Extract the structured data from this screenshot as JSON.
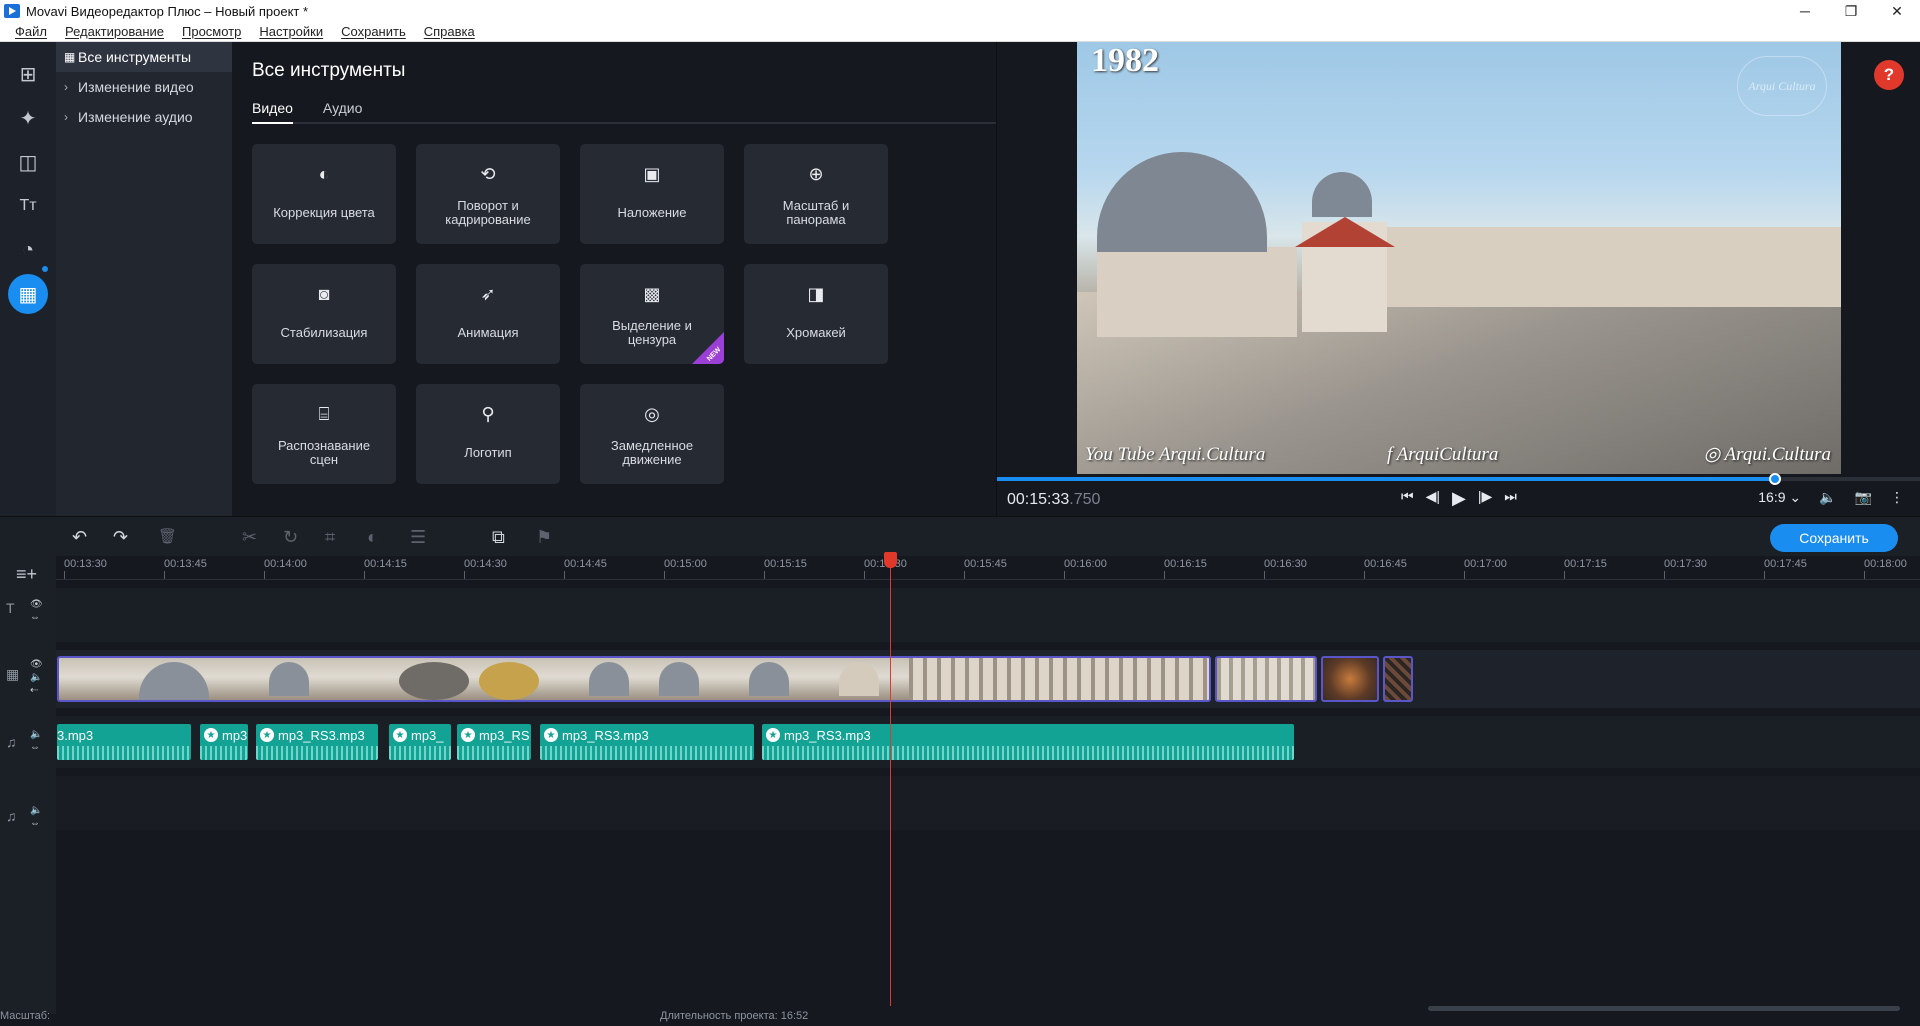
{
  "window": {
    "title": "Movavi Видеоредактор Плюс – Новый проект *",
    "controls": [
      "─",
      "❐",
      "✕"
    ]
  },
  "menu": [
    "Файл",
    "Редактирование",
    "Просмотр",
    "Настройки",
    "Сохранить",
    "Справка"
  ],
  "rail": {
    "icons": [
      "import-icon",
      "magic-wand-icon",
      "transitions-icon",
      "titles-icon",
      "filters-icon",
      "all-tools-icon"
    ],
    "glyphs": [
      "⊞",
      "✦",
      "◫",
      "Tт",
      "◔",
      "▦"
    ],
    "active_index": 5
  },
  "categories": [
    {
      "label": "Все инструменты",
      "icon": "▦",
      "active": true
    },
    {
      "label": "Изменение видео",
      "icon": "›",
      "active": false
    },
    {
      "label": "Изменение аудио",
      "icon": "›",
      "active": false
    }
  ],
  "tools": {
    "title": "Все инструменты",
    "tabs": [
      "Видео",
      "Аудио"
    ],
    "active_tab": 0,
    "cards": [
      {
        "label": "Коррекция цвета",
        "icon": "◐",
        "icon_name": "color-correction-icon"
      },
      {
        "label": "Поворот и кадрирование",
        "icon": "⟲",
        "icon_name": "rotate-crop-icon"
      },
      {
        "label": "Наложение",
        "icon": "▣",
        "icon_name": "overlay-icon"
      },
      {
        "label": "Масштаб и панорама",
        "icon": "⊕",
        "icon_name": "zoom-pan-icon"
      },
      {
        "label": "Стабилизация",
        "icon": "◙",
        "icon_name": "stabilization-icon"
      },
      {
        "label": "Анимация",
        "icon": "➶",
        "icon_name": "animation-icon"
      },
      {
        "label": "Выделение и цензура",
        "icon": "▩",
        "icon_name": "highlight-censor-icon",
        "badge": "NEW"
      },
      {
        "label": "Хромакей",
        "icon": "◨",
        "icon_name": "chroma-key-icon"
      },
      {
        "label": "Распознавание сцен",
        "icon": "⌸",
        "icon_name": "scene-detection-icon"
      },
      {
        "label": "Логотип",
        "icon": "⚲",
        "icon_name": "logo-icon"
      },
      {
        "label": "Замедленное движение",
        "icon": "◎",
        "icon_name": "slow-motion-icon"
      }
    ]
  },
  "preview": {
    "overlay_year": "1982",
    "watermark_logo": "Arqui Cultura",
    "watermarks": [
      "You Tube Arqui.Cultura",
      "f ArquiCultura",
      "◎ Arqui.Cultura"
    ],
    "help": "?",
    "timecode_main": "00:15:33",
    "timecode_ms": ".750",
    "progress": 0.842,
    "aspect": "16:9 ⌄",
    "playback_glyphs": [
      "⏮",
      "◀|",
      "▶",
      "|▶",
      "⏭"
    ],
    "right_glyphs": [
      "🔈",
      "📷",
      "⋮"
    ]
  },
  "toolbar": {
    "save_label": "Сохранить",
    "buttons": [
      {
        "name": "undo-icon",
        "glyph": "↶",
        "enabled": true
      },
      {
        "name": "redo-icon",
        "glyph": "↷",
        "enabled": true
      },
      {
        "name": "delete-icon",
        "glyph": "🗑",
        "enabled": false
      },
      {
        "name": "cut-icon",
        "glyph": "✂",
        "enabled": false
      },
      {
        "name": "rotate-icon",
        "glyph": "↻",
        "enabled": false
      },
      {
        "name": "crop-icon",
        "glyph": "⌗",
        "enabled": false
      },
      {
        "name": "color-icon",
        "glyph": "◐",
        "enabled": false
      },
      {
        "name": "settings-icon",
        "glyph": "☰",
        "enabled": false
      },
      {
        "name": "overlay-icon",
        "glyph": "⧉",
        "enabled": true
      },
      {
        "name": "marker-icon",
        "glyph": "⚑",
        "enabled": false
      }
    ]
  },
  "timeline": {
    "ruler": [
      "00:13:30",
      "00:13:45",
      "00:14:00",
      "00:14:15",
      "00:14:30",
      "00:14:45",
      "00:15:00",
      "00:15:15",
      "00:15:30",
      "00:15:45",
      "00:16:00",
      "00:16:15",
      "00:16:30",
      "00:16:45",
      "00:17:00",
      "00:17:15",
      "00:17:30",
      "00:17:45",
      "00:18:00"
    ],
    "audio_clips": [
      {
        "name": "3.mp3",
        "star": false
      },
      {
        "name": "mp3",
        "star": true
      },
      {
        "name": "mp3_RS3.mp3",
        "star": true
      },
      {
        "name": "mp3_",
        "star": true
      },
      {
        "name": "mp3_RS",
        "star": true
      },
      {
        "name": "mp3_RS3.mp3",
        "star": true
      },
      {
        "name": "mp3_RS3.mp3",
        "star": true
      }
    ],
    "zoom_label": "Масштаб:",
    "duration": "Длительность проекта: 16:52"
  }
}
